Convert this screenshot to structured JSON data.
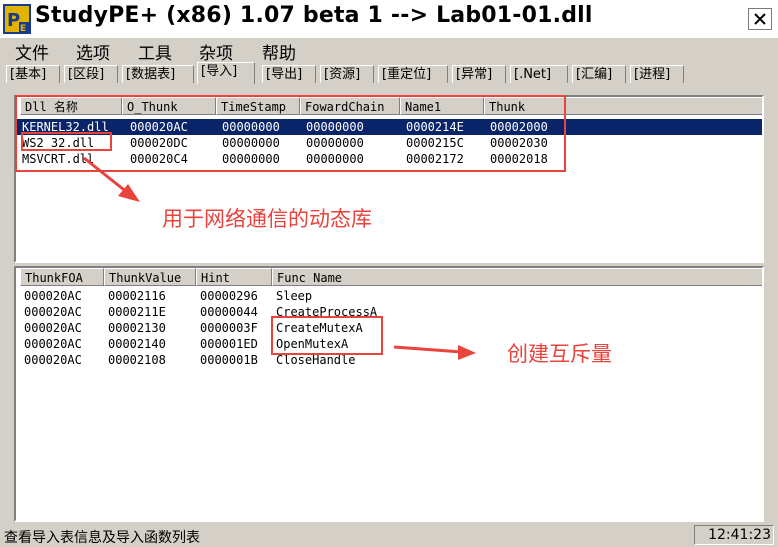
{
  "window": {
    "title": "StudyPE+ (x86) 1.07 beta 1  --> Lab01-01.dll"
  },
  "menu": [
    "文件",
    "选项",
    "工具",
    "杂项",
    "帮助"
  ],
  "tabs": [
    "[基本]",
    "[区段]",
    "[数据表]",
    "[导入]",
    "[导出]",
    "[资源]",
    "[重定位]",
    "[异常]",
    "[.Net]",
    "[汇编]",
    "[进程]"
  ],
  "active_tab": "[导入]",
  "dll_table": {
    "columns": [
      "Dll 名称",
      "O_Thunk",
      "TimeStamp",
      "FowardChain",
      "Name1",
      "Thunk"
    ],
    "rows": [
      [
        "KERNEL32.dll",
        "000020AC",
        "00000000",
        "00000000",
        "0000214E",
        "00002000"
      ],
      [
        "WS2_32.dll",
        "000020DC",
        "00000000",
        "00000000",
        "0000215C",
        "00002030"
      ],
      [
        "MSVCRT.dll",
        "000020C4",
        "00000000",
        "00000000",
        "00002172",
        "00002018"
      ]
    ]
  },
  "func_table": {
    "columns": [
      "ThunkFOA",
      "ThunkValue",
      "Hint",
      "Func Name"
    ],
    "rows": [
      [
        "000020AC",
        "00002116",
        "00000296",
        "Sleep"
      ],
      [
        "000020AC",
        "0000211E",
        "00000044",
        "CreateProcessA"
      ],
      [
        "000020AC",
        "00002130",
        "0000003F",
        "CreateMutexA"
      ],
      [
        "000020AC",
        "00002140",
        "000001ED",
        "OpenMutexA"
      ],
      [
        "000020AC",
        "00002108",
        "0000001B",
        "CloseHandle"
      ]
    ]
  },
  "annotations": {
    "network_dll": "用于网络通信的动态库",
    "mutex": "创建互斥量"
  },
  "status": {
    "text": "查看导入表信息及导入函数列表",
    "clock": "12:41:23"
  }
}
